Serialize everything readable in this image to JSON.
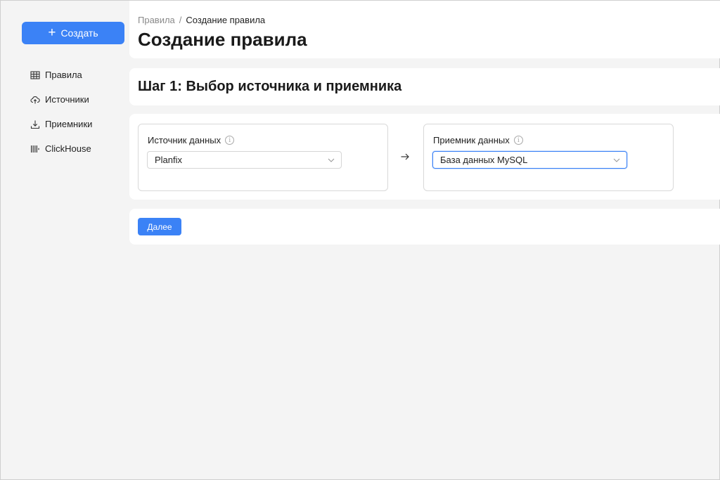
{
  "sidebar": {
    "create_label": "Создать",
    "items": [
      {
        "label": "Правила",
        "icon": "table-icon"
      },
      {
        "label": "Источники",
        "icon": "cloud-upload-icon"
      },
      {
        "label": "Приемники",
        "icon": "download-icon"
      },
      {
        "label": "ClickHouse",
        "icon": "clickhouse-icon"
      }
    ]
  },
  "header": {
    "breadcrumb": {
      "parent": "Правила",
      "separator": "/",
      "current": "Создание правила"
    },
    "title": "Создание правила"
  },
  "step": {
    "title": "Шаг 1: Выбор источника и приемника"
  },
  "source": {
    "label": "Источник данных",
    "value": "Planfix"
  },
  "destination": {
    "label": "Приемник данных",
    "value": "База данных MySQL"
  },
  "actions": {
    "next_label": "Далее"
  },
  "colors": {
    "accent": "#3b82f6",
    "background": "#f4f4f4",
    "card": "#ffffff"
  }
}
